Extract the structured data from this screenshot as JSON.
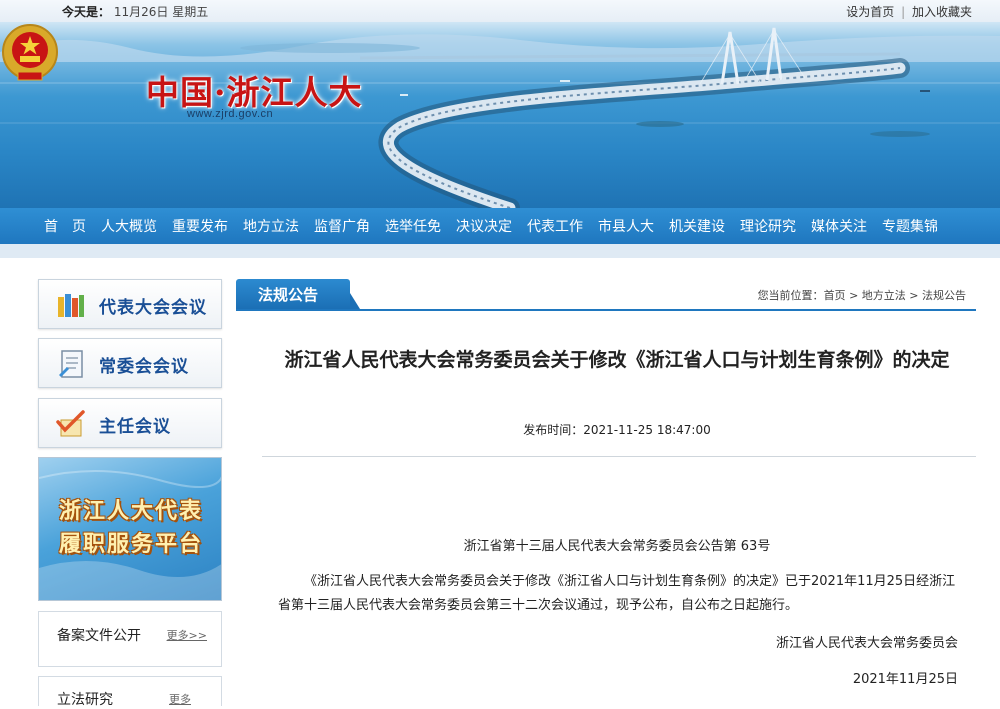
{
  "topbar": {
    "today_label": "今天是：",
    "date": "11月26日 星期五",
    "set_home": "设为首页",
    "separator": "|",
    "add_favorite": "加入收藏夹"
  },
  "brand": {
    "title": "中国·浙江人大",
    "url": "www.zjrd.gov.cn"
  },
  "nav": {
    "items": [
      "首　页",
      "人大概览",
      "重要发布",
      "地方立法",
      "监督广角",
      "选举任免",
      "决议决定",
      "代表工作",
      "市县人大",
      "机关建设",
      "理论研究",
      "媒体关注",
      "专题集锦"
    ]
  },
  "sidebar": {
    "buttons": [
      {
        "label": "代表大会会议",
        "icon": "books-icon"
      },
      {
        "label": "常委会会议",
        "icon": "document-icon"
      },
      {
        "label": "主任会议",
        "icon": "checkmark-pen-icon"
      }
    ],
    "promo": {
      "line1": "浙江人大代表",
      "line2": "履职服务平台"
    },
    "panel1": {
      "title": "备案文件公开",
      "more": "更多>>"
    },
    "panel2": {
      "title": "立法研究",
      "more": "更多"
    }
  },
  "content": {
    "tab": "法规公告",
    "breadcrumb": {
      "prefix": "您当前位置：",
      "items": [
        "首页",
        "地方立法",
        "法规公告"
      ],
      "sep": ">"
    },
    "title": "浙江省人民代表大会常务委员会关于修改《浙江省人口与计划生育条例》的决定",
    "pubtime": "发布时间：2021-11-25 18:47:00",
    "announcement": "浙江省第十三届人民代表大会常务委员会公告第 63号",
    "body": "《浙江省人民代表大会常务委员会关于修改《浙江省人口与计划生育条例》的决定》已于2021年11月25日经浙江省第十三届人民代表大会常务委员会第三十二次会议通过，现予公布，自公布之日起施行。",
    "signature": "浙江省人民代表大会常务委员会",
    "sign_date": "2021年11月25日"
  },
  "colors": {
    "nav_blue": "#1f77bf",
    "brand_red": "#c81414",
    "sidebar_label": "#1a4f96"
  }
}
